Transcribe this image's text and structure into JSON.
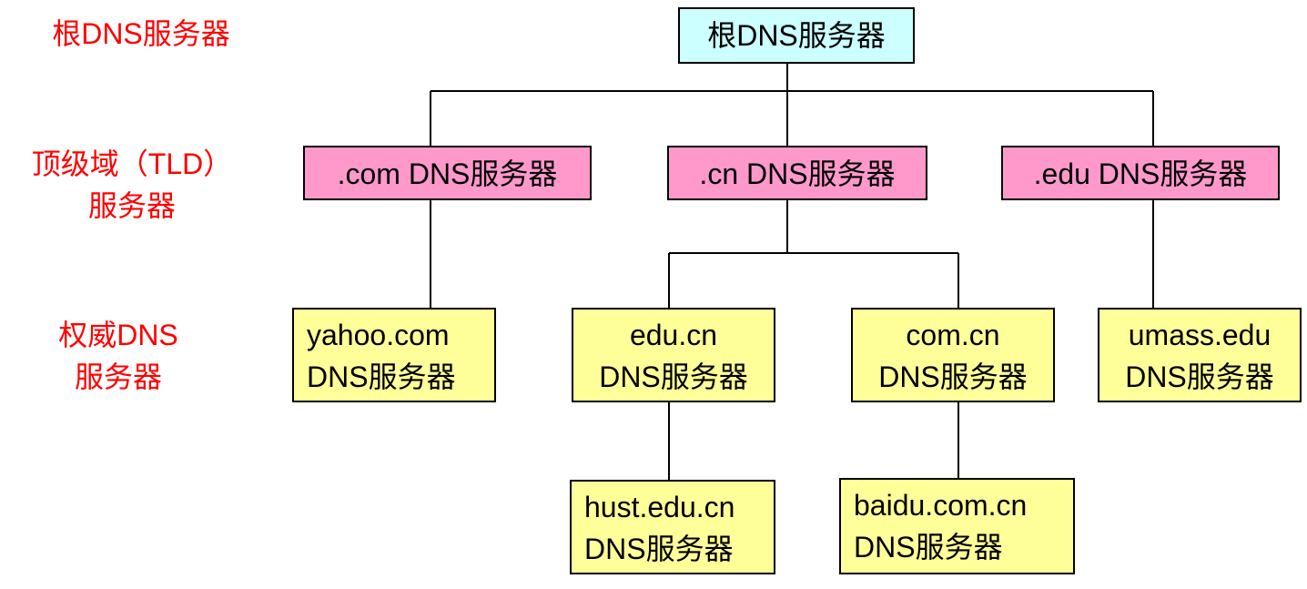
{
  "level_labels": {
    "root": {
      "l1": "根DNS服务器"
    },
    "tld": {
      "l1": "顶级域（TLD）",
      "l2": "服务器"
    },
    "authoritative": {
      "l1": "权威DNS",
      "l2": "服务器"
    }
  },
  "nodes": {
    "root": {
      "l1": "根DNS服务器"
    },
    "com": {
      "l1": ".com DNS服务器"
    },
    "cn": {
      "l1": ".cn DNS服务器"
    },
    "edu": {
      "l1": ".edu DNS服务器"
    },
    "yahoo": {
      "l1": "yahoo.com",
      "l2": "DNS服务器"
    },
    "educn": {
      "l1": "edu.cn",
      "l2": "DNS服务器"
    },
    "comcn": {
      "l1": "com.cn",
      "l2": "DNS服务器"
    },
    "umass": {
      "l1": "umass.edu",
      "l2": "DNS服务器"
    },
    "hust": {
      "l1": "hust.edu.cn",
      "l2": "DNS服务器"
    },
    "baidu": {
      "l1": "baidu.com.cn",
      "l2": "DNS服务器"
    }
  },
  "colors": {
    "root_fill": "#ccffff",
    "tld_fill": "#ff99cc",
    "authoritative_fill": "#ffff99",
    "label_color": "#ff0000",
    "line_color": "#000000"
  }
}
